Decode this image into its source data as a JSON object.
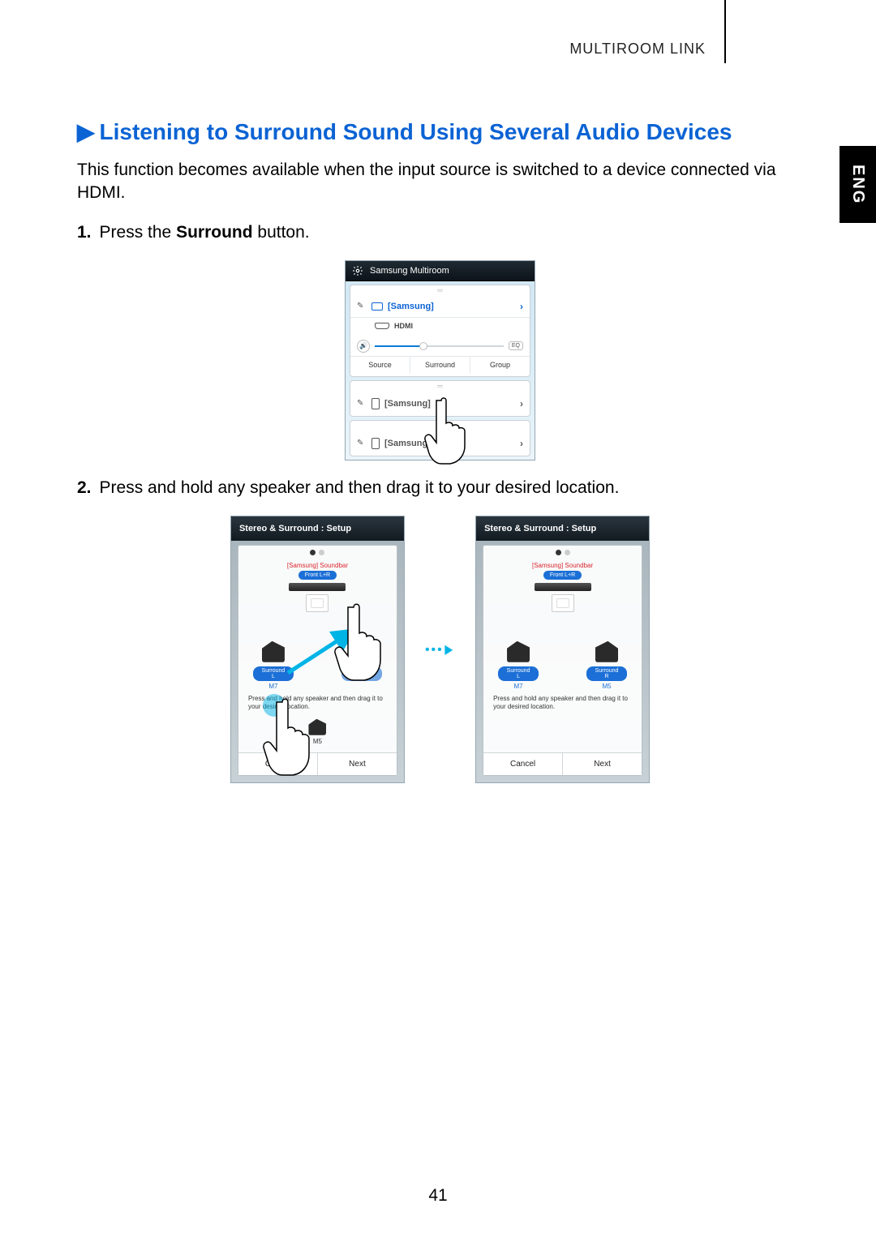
{
  "header": {
    "section": "MULTIROOM LINK"
  },
  "lang_tab": "ENG",
  "title": "Listening to Surround Sound Using Several Audio Devices",
  "intro": "This function becomes available when the input source is switched to a device connected via HDMI.",
  "steps": {
    "s1_num": "1.",
    "s1_a": "Press the ",
    "s1_b": "Surround",
    "s1_c": " button.",
    "s2_num": "2.",
    "s2": "Press and hold any speaker and then drag it to your desired location."
  },
  "phone1": {
    "title": "Samsung Multiroom",
    "device1": "[Samsung]",
    "hdmi": "HDMI",
    "eq": "EQ",
    "btn_source": "Source",
    "btn_surround": "Surround",
    "btn_group": "Group",
    "device2": "[Samsung]",
    "device3": "[Samsung] M5"
  },
  "setup": {
    "title": "Stereo & Surround : Setup",
    "soundbar": "[Samsung] Soundbar",
    "front": "Front L+R",
    "surL": "Surround L",
    "surR": "Surround R",
    "m7": "M7",
    "m5": "M5",
    "hint": "Press and hold any speaker and then drag it to your desired location.",
    "cancel": "Cancel",
    "next": "Next"
  },
  "page_number": "41"
}
